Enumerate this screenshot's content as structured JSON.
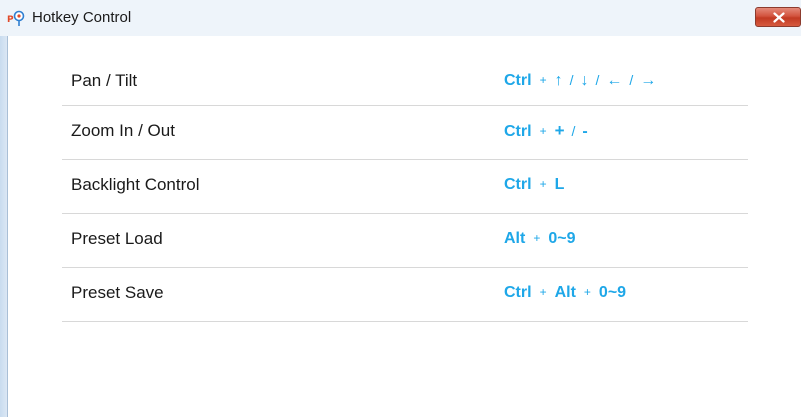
{
  "window": {
    "title": "Hotkey Control",
    "close_icon": "close-icon",
    "accent_color": "#1ea7e8"
  },
  "hotkeys": [
    {
      "action": "Pan / Tilt",
      "combo": [
        {
          "type": "key",
          "text": "Ctrl"
        },
        {
          "type": "plus",
          "text": "+"
        },
        {
          "type": "sym",
          "text": "↑"
        },
        {
          "type": "slash",
          "text": "/"
        },
        {
          "type": "sym",
          "text": "↓"
        },
        {
          "type": "slash",
          "text": "/"
        },
        {
          "type": "sym",
          "text": "←"
        },
        {
          "type": "slash",
          "text": "/"
        },
        {
          "type": "sym",
          "text": "→"
        }
      ]
    },
    {
      "action": "Zoom In / Out",
      "combo": [
        {
          "type": "key",
          "text": "Ctrl"
        },
        {
          "type": "plus",
          "text": "+"
        },
        {
          "type": "key",
          "text": "+"
        },
        {
          "type": "slash",
          "text": "/"
        },
        {
          "type": "key",
          "text": "-"
        }
      ]
    },
    {
      "action": "Backlight Control",
      "combo": [
        {
          "type": "key",
          "text": "Ctrl"
        },
        {
          "type": "plus",
          "text": "+"
        },
        {
          "type": "key",
          "text": "L"
        }
      ]
    },
    {
      "action": "Preset Load",
      "combo": [
        {
          "type": "key",
          "text": "Alt"
        },
        {
          "type": "plus",
          "text": "+"
        },
        {
          "type": "key",
          "text": "0~9"
        }
      ]
    },
    {
      "action": "Preset Save",
      "combo": [
        {
          "type": "key",
          "text": "Ctrl"
        },
        {
          "type": "plus",
          "text": "+"
        },
        {
          "type": "key",
          "text": "Alt"
        },
        {
          "type": "plus",
          "text": "+"
        },
        {
          "type": "key",
          "text": "0~9"
        }
      ]
    }
  ]
}
